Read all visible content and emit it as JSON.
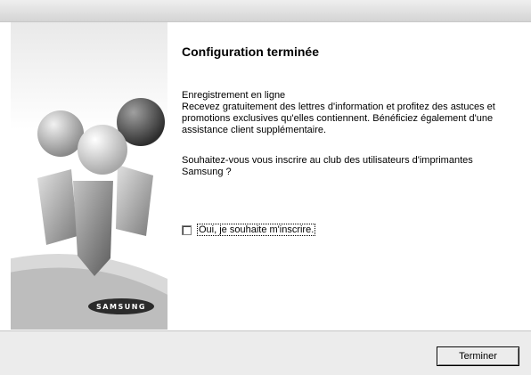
{
  "dialog": {
    "title": "Configuration terminée",
    "paragraph1": "Enregistrement en ligne\nRecevez gratuitement des lettres d'information et profitez des astuces et promotions exclusives qu'elles contiennent. Bénéficiez également d'une assistance client supplémentaire.",
    "paragraph2": "Souhaitez-vous vous inscrire au club des utilisateurs d'imprimantes Samsung ?",
    "checkbox_label": "Oui, je souhaite m'inscrire.",
    "checkbox_checked": false,
    "finish_button": "Terminer"
  },
  "side_panel": {
    "logo_text": "SAMSUNG",
    "figure_icon": "users-figures-icon"
  },
  "colors": {
    "sphere_green": "#9a9a9a",
    "sphere_red": "#5a5a5a",
    "sphere_blue": "#c8c8c8",
    "logo_bg": "#2b2b2b"
  }
}
